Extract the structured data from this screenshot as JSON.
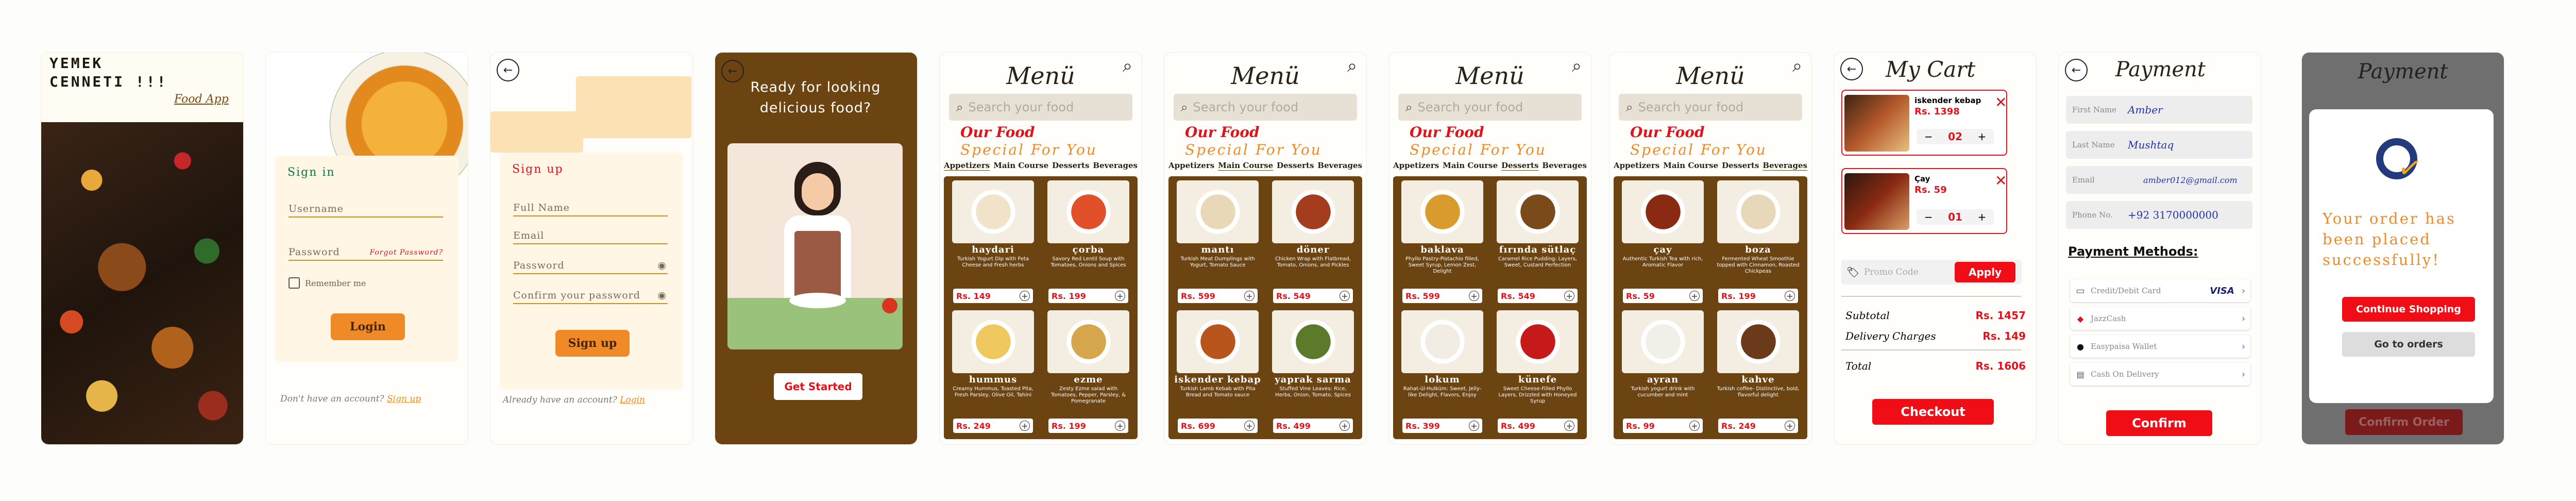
{
  "colors": {
    "brown": "#6b4412",
    "red": "#e0121b",
    "orange": "#ef8a26",
    "cream": "#fff6e5"
  },
  "splash": {
    "title_line1": "YEMEK",
    "title_line2": "CENNETI !!!",
    "subtitle": "Food App"
  },
  "login": {
    "heading": "Sign in",
    "username_placeholder": "Username",
    "password_placeholder": "Password",
    "forgot": "Forgot Password?",
    "remember": "Remember me",
    "button": "Login",
    "footer_text": "Don't have an account?",
    "footer_link": "Sign up"
  },
  "signup": {
    "heading": "Sign up",
    "full_name": "Full Name",
    "email": "Email",
    "password": "Password",
    "confirm": "Confirm your password",
    "button": "Sign up",
    "footer_text": "Already have an account?",
    "footer_link": "Login"
  },
  "onboarding": {
    "headline": "Ready for looking delicious food?",
    "button": "Get Started"
  },
  "menu": {
    "title": "Menü",
    "search_placeholder": "Search your food",
    "our_food": "Our Food",
    "special": "Special For You",
    "tabs": [
      "Appetizers",
      "Main Course",
      "Desserts",
      "Beverages"
    ],
    "pages": [
      {
        "active_tab": 0,
        "items": [
          {
            "name": "haydari",
            "desc": "Turkish Yogurt Dip with Feta Cheese and Fresh herbs",
            "price": "Rs. 149"
          },
          {
            "name": "çorba",
            "desc": "Savory Red Lentil Soup with Tomatoes, Onions and Spices",
            "price": "Rs. 199"
          },
          {
            "name": "hummus",
            "desc": "Creamy Hummus, Toasted Pita, Fresh Parsley, Olive Oil, Tahini",
            "price": "Rs. 249"
          },
          {
            "name": "ezme",
            "desc": "Zesty Ezme salad with Tomatoes, Pepper, Parsley, & Pomegranate",
            "price": "Rs. 199"
          }
        ]
      },
      {
        "active_tab": 1,
        "items": [
          {
            "name": "mantı",
            "desc": "Turkish Meat Dumplings with Yogurt, Tomato Sauce",
            "price": "Rs. 599"
          },
          {
            "name": "döner",
            "desc": "Chicken Wrap with Flatbread, Tomato, Onions, and Pickles",
            "price": "Rs. 549"
          },
          {
            "name": "iskender kebap",
            "desc": "Turkish Lamb Kebab with Pita Bread and Tomato sauce",
            "price": "Rs. 699"
          },
          {
            "name": "yaprak sarma",
            "desc": "Stuffed Vine Leaves: Rice, Herbs, Onion, Tomato, Spices",
            "price": "Rs. 499"
          }
        ]
      },
      {
        "active_tab": 2,
        "items": [
          {
            "name": "baklava",
            "desc": "Phyllo Pastry-Pistachio filled, Sweet Syrup, Lemon Zest, Delight",
            "price": "Rs. 599"
          },
          {
            "name": "fırında sütlaç",
            "desc": "Caramel Rice Pudding: Layers, Sweet, Custard Perfection",
            "price": "Rs. 549"
          },
          {
            "name": "lokum",
            "desc": "Rahat-ül-Hulküm: Sweet, Jelly-like Delight, Flavors, Enjoy",
            "price": "Rs. 399"
          },
          {
            "name": "künefe",
            "desc": "Sweet Cheese-Filled Phyllo Layers, Drizzled with Honeyed Syrup",
            "price": "Rs. 499"
          }
        ]
      },
      {
        "active_tab": 3,
        "items": [
          {
            "name": "çay",
            "desc": "Authentic Turkish Tea with rich, Aromatic Flavor",
            "price": "Rs. 59"
          },
          {
            "name": "boza",
            "desc": "Fermented Wheat Smoothie topped with Cinnamon, Roasted Chickpeas",
            "price": "Rs. 199"
          },
          {
            "name": "ayran",
            "desc": "Turkish yogurt drink with cucumber and mint",
            "price": "Rs. 99"
          },
          {
            "name": "kahve",
            "desc": "Turkish coffee- Distinctive, bold, flavorful delight",
            "price": "Rs. 249"
          }
        ]
      }
    ]
  },
  "cart": {
    "title": "My Cart",
    "items": [
      {
        "name": "iskender kebap",
        "price": "Rs. 1398",
        "qty": "02"
      },
      {
        "name": "Çay",
        "price": "Rs. 59",
        "qty": "01"
      }
    ],
    "promo_placeholder": "Promo Code",
    "apply": "Apply",
    "subtotal_label": "Subtotal",
    "subtotal": "Rs. 1457",
    "delivery_label": "Delivery Charges",
    "delivery": "Rs. 149",
    "total_label": "Total",
    "total": "Rs. 1606",
    "checkout": "Checkout"
  },
  "payment": {
    "title": "Payment",
    "first_name_label": "First Name",
    "first_name": "Amber",
    "last_name_label": "Last Name",
    "last_name": "Mushtaq",
    "email_label": "Email",
    "email": "amber012@gmail.com",
    "phone_label": "Phone No.",
    "phone": "+92 3170000000",
    "methods_heading": "Payment Methods:",
    "methods": [
      {
        "name": "Credit/Debit Card",
        "badge": "VISA"
      },
      {
        "name": "JazzCash",
        "badge": ""
      },
      {
        "name": "Easypaisa Wallet",
        "badge": ""
      },
      {
        "name": "Cash On Delivery",
        "badge": ""
      }
    ],
    "confirm": "Confirm"
  },
  "success": {
    "title": "Payment",
    "message": "Your order has been placed successfully!",
    "continue": "Continue Shopping",
    "goto": "Go to orders",
    "confirm_order": "Confirm Order"
  }
}
